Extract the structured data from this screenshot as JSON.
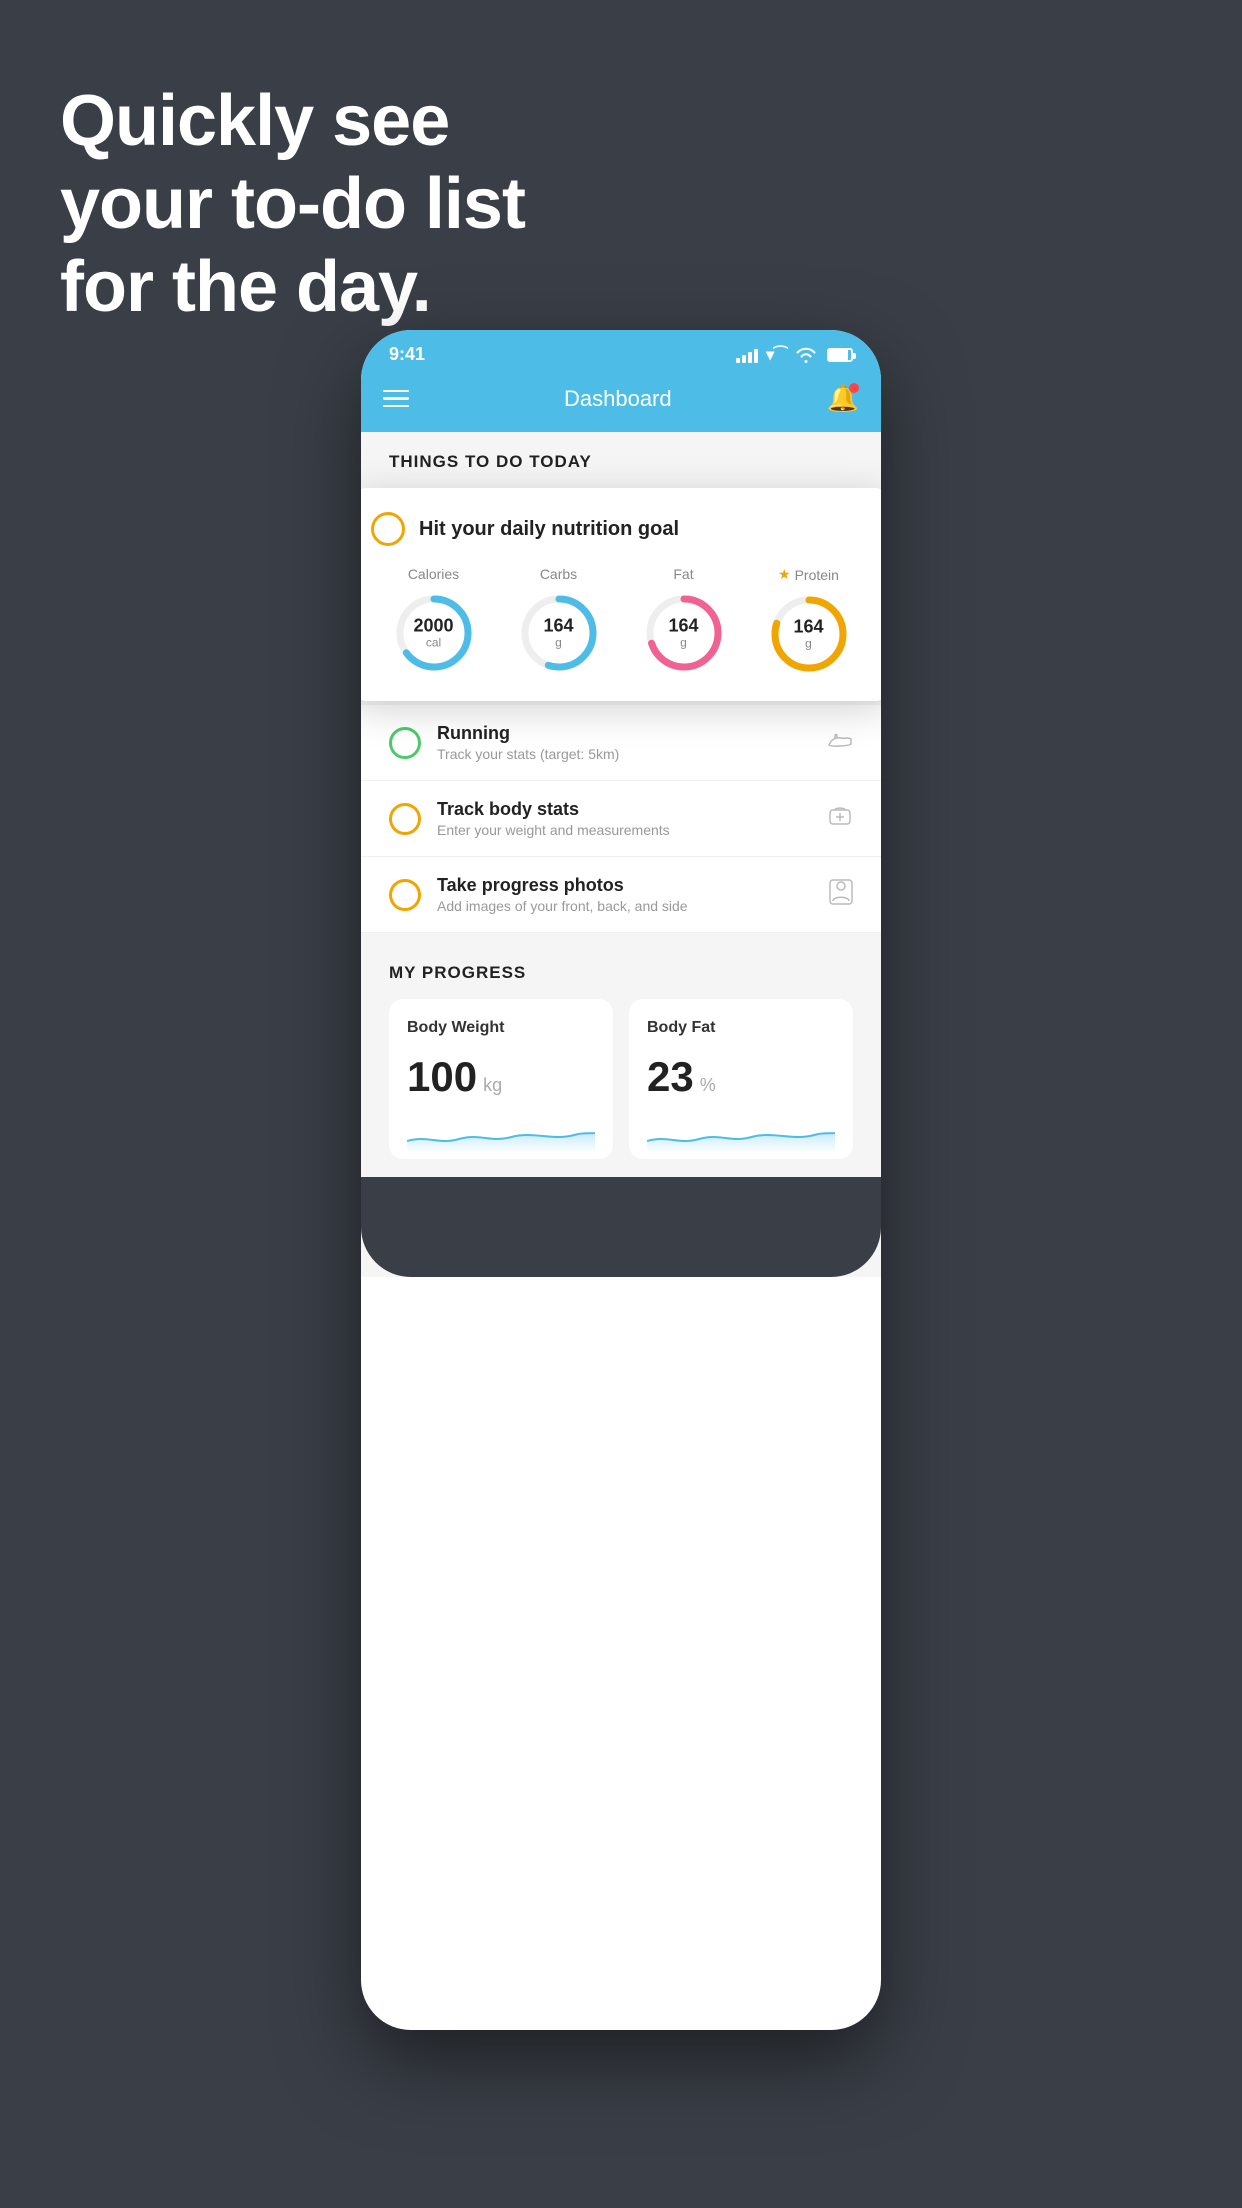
{
  "hero": {
    "line1": "Quickly see",
    "line2": "your to-do list",
    "line3": "for the day."
  },
  "status_bar": {
    "time": "9:41"
  },
  "nav": {
    "title": "Dashboard"
  },
  "things_today": {
    "section_label": "THINGS TO DO TODAY"
  },
  "floating_card": {
    "title": "Hit your daily nutrition goal",
    "items": [
      {
        "label": "Calories",
        "value": "2000",
        "unit": "cal",
        "color": "#4dbde8",
        "pct": 65,
        "starred": false
      },
      {
        "label": "Carbs",
        "value": "164",
        "unit": "g",
        "color": "#4dbde8",
        "pct": 55,
        "starred": false
      },
      {
        "label": "Fat",
        "value": "164",
        "unit": "g",
        "color": "#f06292",
        "pct": 70,
        "starred": false
      },
      {
        "label": "Protein",
        "value": "164",
        "unit": "g",
        "color": "#f0a500",
        "pct": 80,
        "starred": true
      }
    ]
  },
  "todo_items": [
    {
      "title": "Running",
      "subtitle": "Track your stats (target: 5km)",
      "circle_color": "green",
      "icon": "shoe"
    },
    {
      "title": "Track body stats",
      "subtitle": "Enter your weight and measurements",
      "circle_color": "yellow",
      "icon": "scale"
    },
    {
      "title": "Take progress photos",
      "subtitle": "Add images of your front, back, and side",
      "circle_color": "yellow",
      "icon": "person"
    }
  ],
  "progress": {
    "section_label": "MY PROGRESS",
    "cards": [
      {
        "title": "Body Weight",
        "value": "100",
        "unit": "kg"
      },
      {
        "title": "Body Fat",
        "value": "23",
        "unit": "%"
      }
    ]
  }
}
